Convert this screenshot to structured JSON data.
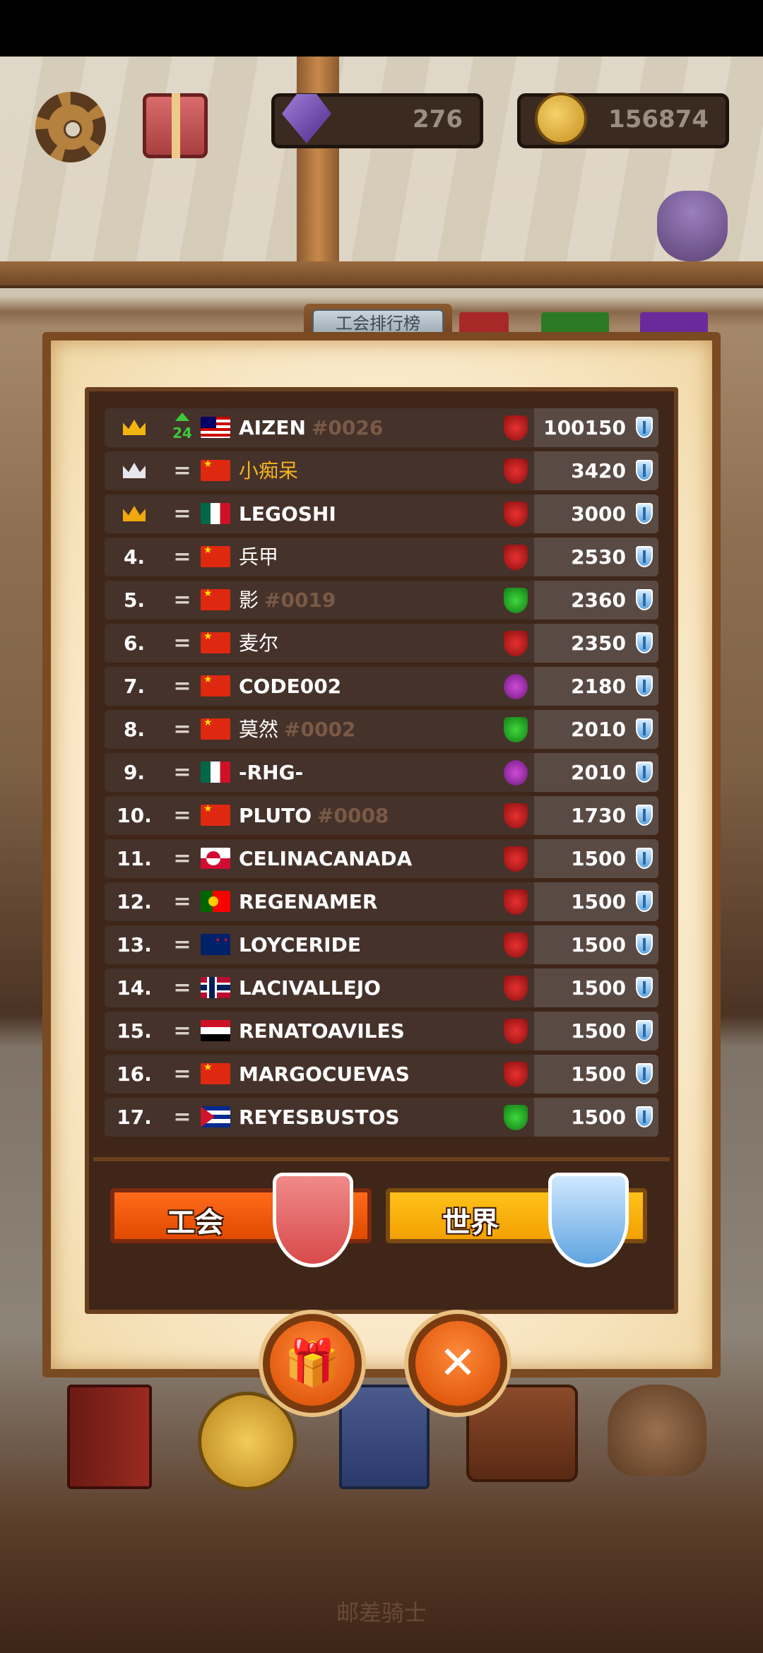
{
  "top_bar": {
    "gems": "276",
    "gold": "156874"
  },
  "board": {
    "title": "工会排行榜"
  },
  "rows": [
    {
      "rank": "",
      "crown": "gold",
      "change": "24",
      "change_dir": "up",
      "flag": "my",
      "name": "AIZEN",
      "tag": "#0026",
      "name_style": "",
      "guild": "red",
      "score": "100150"
    },
    {
      "rank": "",
      "crown": "silver",
      "change": "=",
      "change_dir": "same",
      "flag": "cn",
      "name": "小痴呆",
      "tag": "",
      "name_style": "yellow",
      "guild": "red",
      "score": "3420"
    },
    {
      "rank": "",
      "crown": "bronze",
      "change": "=",
      "change_dir": "same",
      "flag": "mx",
      "name": "LEGOSHI",
      "tag": "",
      "name_style": "",
      "guild": "red",
      "score": "3000"
    },
    {
      "rank": "4.",
      "crown": "",
      "change": "=",
      "change_dir": "same",
      "flag": "cn",
      "name": "兵甲",
      "tag": "",
      "name_style": "cjk",
      "guild": "red",
      "score": "2530"
    },
    {
      "rank": "5.",
      "crown": "",
      "change": "=",
      "change_dir": "same",
      "flag": "cn",
      "name": "影",
      "tag": "#0019",
      "name_style": "cjk",
      "guild": "green",
      "score": "2360"
    },
    {
      "rank": "6.",
      "crown": "",
      "change": "=",
      "change_dir": "same",
      "flag": "cn",
      "name": "麦尔",
      "tag": "",
      "name_style": "cjk",
      "guild": "red",
      "score": "2350"
    },
    {
      "rank": "7.",
      "crown": "",
      "change": "=",
      "change_dir": "same",
      "flag": "cn",
      "name": "CODE002",
      "tag": "",
      "name_style": "",
      "guild": "purple",
      "score": "2180"
    },
    {
      "rank": "8.",
      "crown": "",
      "change": "=",
      "change_dir": "same",
      "flag": "cn",
      "name": "莫然",
      "tag": "#0002",
      "name_style": "cjk",
      "guild": "green",
      "score": "2010"
    },
    {
      "rank": "9.",
      "crown": "",
      "change": "=",
      "change_dir": "same",
      "flag": "mx",
      "name": "-RHG-",
      "tag": "",
      "name_style": "",
      "guild": "purple",
      "score": "2010"
    },
    {
      "rank": "10.",
      "crown": "",
      "change": "=",
      "change_dir": "same",
      "flag": "cn",
      "name": "PLUTO",
      "tag": "#0008",
      "name_style": "",
      "guild": "red",
      "score": "1730"
    },
    {
      "rank": "11.",
      "crown": "",
      "change": "=",
      "change_dir": "same",
      "flag": "gl",
      "name": "CELINACANADA",
      "tag": "",
      "name_style": "",
      "guild": "red",
      "score": "1500"
    },
    {
      "rank": "12.",
      "crown": "",
      "change": "=",
      "change_dir": "same",
      "flag": "pt",
      "name": "REGENAMER",
      "tag": "",
      "name_style": "",
      "guild": "red",
      "score": "1500"
    },
    {
      "rank": "13.",
      "crown": "",
      "change": "=",
      "change_dir": "same",
      "flag": "nz",
      "name": "LOYCERIDE",
      "tag": "",
      "name_style": "",
      "guild": "red",
      "score": "1500"
    },
    {
      "rank": "14.",
      "crown": "",
      "change": "=",
      "change_dir": "same",
      "flag": "no",
      "name": "LACIVALLEJO",
      "tag": "",
      "name_style": "",
      "guild": "red",
      "score": "1500"
    },
    {
      "rank": "15.",
      "crown": "",
      "change": "=",
      "change_dir": "same",
      "flag": "eg",
      "name": "RENATOAVILES",
      "tag": "",
      "name_style": "",
      "guild": "red",
      "score": "1500"
    },
    {
      "rank": "16.",
      "crown": "",
      "change": "=",
      "change_dir": "same",
      "flag": "cn",
      "name": "MARGOCUEVAS",
      "tag": "",
      "name_style": "",
      "guild": "red",
      "score": "1500"
    },
    {
      "rank": "17.",
      "crown": "",
      "change": "=",
      "change_dir": "same",
      "flag": "cu",
      "name": "REYESBUSTOS",
      "tag": "",
      "name_style": "",
      "guild": "green",
      "score": "1500"
    }
  ],
  "buttons": {
    "guild": "工会",
    "world": "世界"
  },
  "footer": {
    "label": "邮差骑士"
  }
}
